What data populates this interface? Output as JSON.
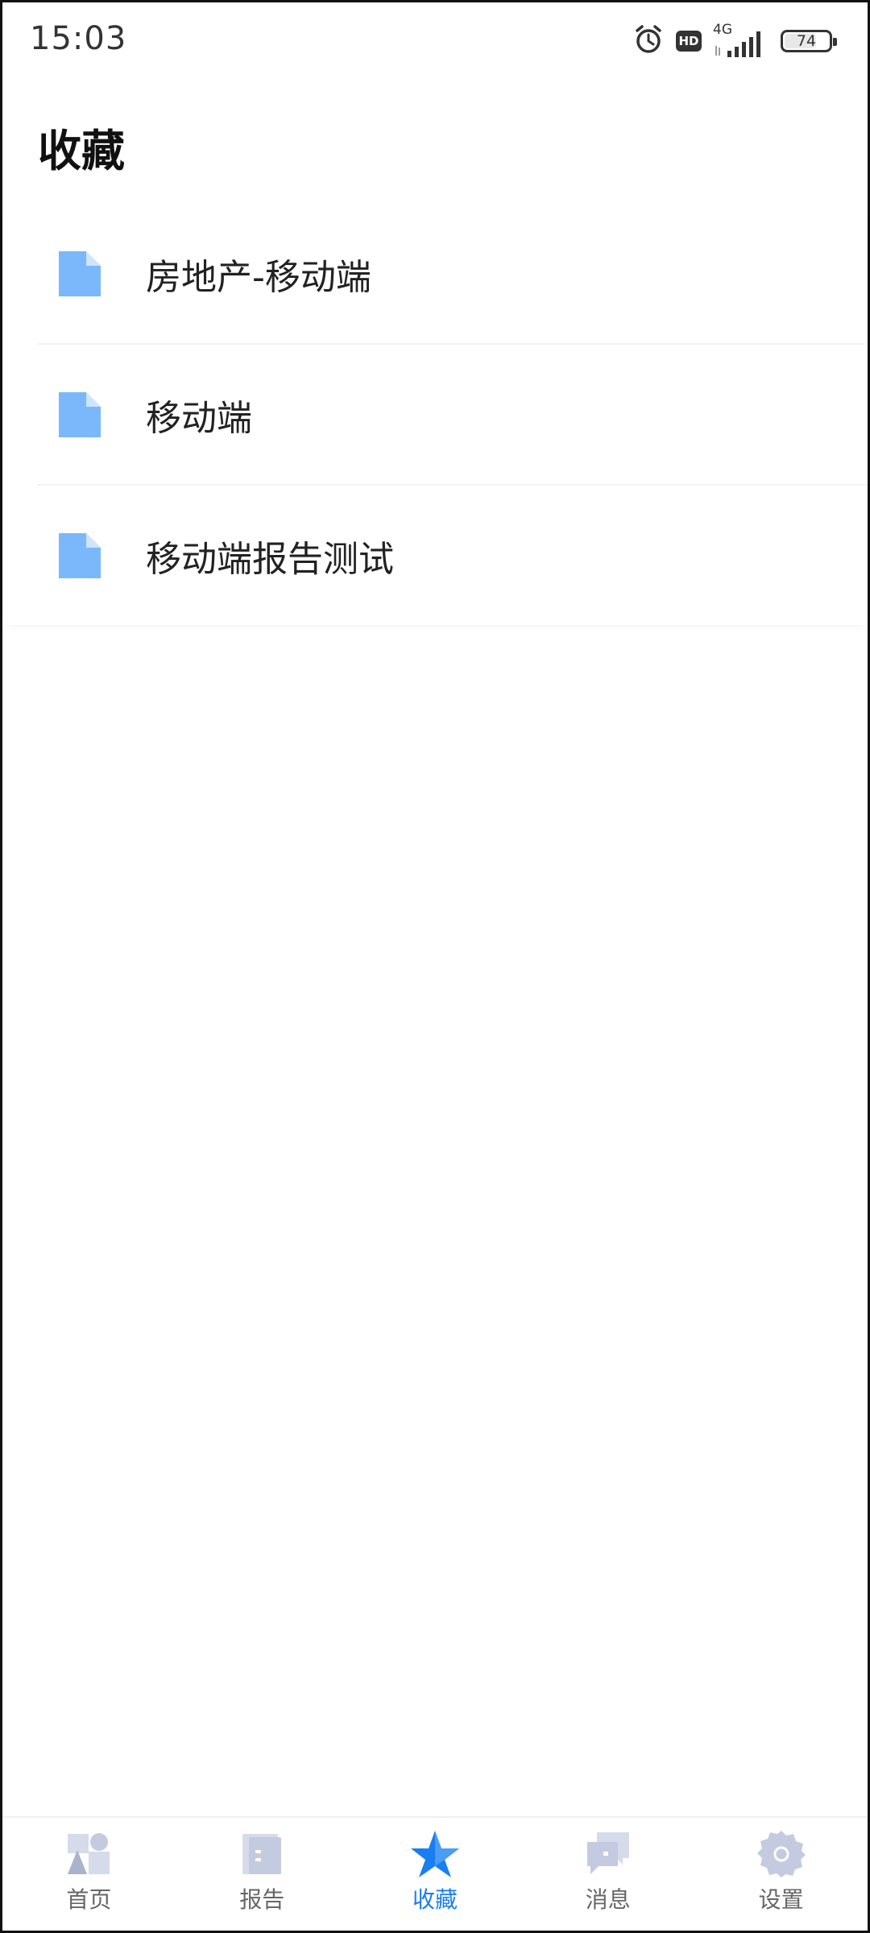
{
  "status_bar": {
    "time": "15:03",
    "hd": "HD",
    "network": "4G",
    "battery": "74",
    "battery_level": 0.74
  },
  "page": {
    "title": "收藏"
  },
  "favorites": [
    {
      "label": "房地产-移动端",
      "icon": "document-icon"
    },
    {
      "label": "移动端",
      "icon": "document-icon"
    },
    {
      "label": "移动端报告测试",
      "icon": "document-icon"
    }
  ],
  "bottom_nav": [
    {
      "label": "首页",
      "icon": "home-icon",
      "active": false
    },
    {
      "label": "报告",
      "icon": "report-icon",
      "active": false
    },
    {
      "label": "收藏",
      "icon": "star-icon",
      "active": true
    },
    {
      "label": "消息",
      "icon": "message-icon",
      "active": false
    },
    {
      "label": "设置",
      "icon": "settings-icon",
      "active": false
    }
  ],
  "colors": {
    "accent": "#1a7df0",
    "doc_icon": "#7ab8fb",
    "nav_inactive": "#c4cbe0"
  }
}
